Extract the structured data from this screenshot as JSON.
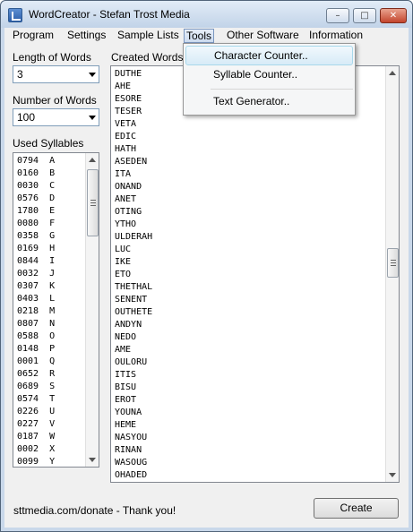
{
  "window": {
    "title": "WordCreator - Stefan Trost Media",
    "controls": {
      "minimize": "–",
      "maximize": "□",
      "close": "✕"
    }
  },
  "menu": {
    "items": [
      "Program",
      "Settings",
      "Sample Lists",
      "Tools",
      "Other Software",
      "Information"
    ],
    "active_index": 3
  },
  "tools_dropdown": {
    "items": [
      "Character Counter..",
      "Syllable Counter..",
      "Text Generator.."
    ],
    "highlighted_index": 0
  },
  "settings": {
    "length_label": "Length of Words",
    "length_value": "3",
    "number_label": "Number of Words",
    "number_value": "100",
    "syllables_label": "Used Syllables"
  },
  "syllables": [
    "0794  A",
    "0160  B",
    "0030  C",
    "0576  D",
    "1780  E",
    "0080  F",
    "0358  G",
    "0169  H",
    "0844  I",
    "0032  J",
    "0307  K",
    "0403  L",
    "0218  M",
    "0807  N",
    "0588  O",
    "0148  P",
    "0001  Q",
    "0652  R",
    "0689  S",
    "0574  T",
    "0226  U",
    "0227  V",
    "0187  W",
    "0002  X",
    "0099  Y"
  ],
  "created": {
    "label": "Created Words",
    "words": [
      "DUTHE",
      "AHE",
      "ESORE",
      "TESER",
      "VETA",
      "EDIC",
      "HATH",
      "ASEDEN",
      "ITA",
      "ONAND",
      "ANET",
      "OTING",
      "YTHO",
      "ULDERAH",
      "LUC",
      "IKE",
      "ETO",
      "THETHAL",
      "SENENT",
      "OUTHETE",
      "ANDYN",
      "NEDO",
      "AME",
      "OULORU",
      "ITIS",
      "BISU",
      "EROT",
      "YOUNA",
      "HEME",
      "NASYOU",
      "RINAN",
      "WASOUG",
      "OHADED"
    ]
  },
  "footer": {
    "status": "sttmedia.com/donate - Thank you!",
    "create_label": "Create"
  },
  "colors": {
    "titlebar": "#c9d8ea",
    "client": "#f0f0f0",
    "highlight": "#d7ebf7",
    "close_button": "#c3452d"
  }
}
